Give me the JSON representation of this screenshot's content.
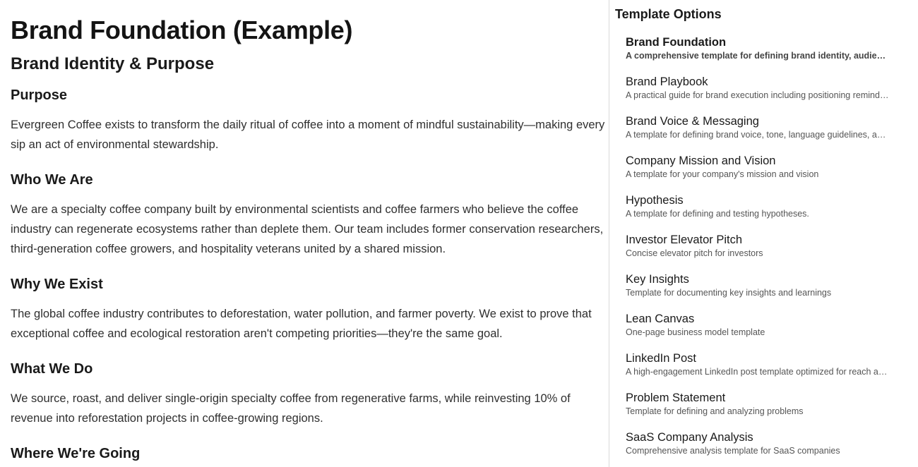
{
  "document": {
    "title": "Brand Foundation (Example)",
    "subtitle": "Brand Identity & Purpose",
    "sections": [
      {
        "heading": "Purpose",
        "body": "Evergreen Coffee exists to transform the daily ritual of coffee into a moment of mindful sustainability—making every sip an act of environmental stewardship."
      },
      {
        "heading": "Who We Are",
        "body": "We are a specialty coffee company built by environmental scientists and coffee farmers who believe the coffee industry can regenerate ecosystems rather than deplete them. Our team includes former conservation researchers, third-generation coffee growers, and hospitality veterans united by a shared mission."
      },
      {
        "heading": "Why We Exist",
        "body": "The global coffee industry contributes to deforestation, water pollution, and farmer poverty. We exist to prove that exceptional coffee and ecological restoration aren't competing priorities—they're the same goal."
      },
      {
        "heading": "What We Do",
        "body": "We source, roast, and deliver single-origin specialty coffee from regenerative farms, while reinvesting 10% of revenue into reforestation projects in coffee-growing regions."
      },
      {
        "heading": "Where We're Going",
        "body": ""
      }
    ]
  },
  "panel": {
    "title": "Template Options",
    "templates": [
      {
        "name": "Brand Foundation",
        "description": "A comprehensive template for defining brand identity, audience, positioning and strategy",
        "selected": true
      },
      {
        "name": "Brand Playbook",
        "description": "A practical guide for brand execution including positioning reminders and examples",
        "selected": false
      },
      {
        "name": "Brand Voice & Messaging",
        "description": "A template for defining brand voice, tone, language guidelines, and messaging",
        "selected": false
      },
      {
        "name": "Company Mission and Vision",
        "description": "A template for your company's mission and vision",
        "selected": false
      },
      {
        "name": "Hypothesis",
        "description": "A template for defining and testing hypotheses.",
        "selected": false
      },
      {
        "name": "Investor Elevator Pitch",
        "description": "Concise elevator pitch for investors",
        "selected": false
      },
      {
        "name": "Key Insights",
        "description": "Template for documenting key insights and learnings",
        "selected": false
      },
      {
        "name": "Lean Canvas",
        "description": "One-page business model template",
        "selected": false
      },
      {
        "name": "LinkedIn Post",
        "description": "A high-engagement LinkedIn post template optimized for reach and interaction",
        "selected": false
      },
      {
        "name": "Problem Statement",
        "description": "Template for defining and analyzing problems",
        "selected": false
      },
      {
        "name": "SaaS Company Analysis",
        "description": "Comprehensive analysis template for SaaS companies",
        "selected": false
      }
    ]
  }
}
